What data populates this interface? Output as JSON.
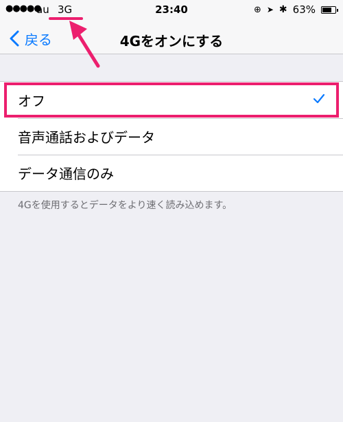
{
  "status_bar": {
    "signal": "●●●●●",
    "carrier": "au",
    "network": "3G",
    "time": "23:40",
    "battery_percent": "63%",
    "battery_level": 0.63
  },
  "nav": {
    "back_label": "戻る",
    "title": "4Gをオンにする"
  },
  "options": [
    {
      "label": "オフ",
      "selected": true
    },
    {
      "label": "音声通話およびデータ",
      "selected": false
    },
    {
      "label": "データ通信のみ",
      "selected": false
    }
  ],
  "footer": "4Gを使用するとデータをより速く読み込めます。",
  "colors": {
    "accent": "#0a7aff",
    "annotation": "#ec1f6e",
    "background": "#efeff4"
  }
}
